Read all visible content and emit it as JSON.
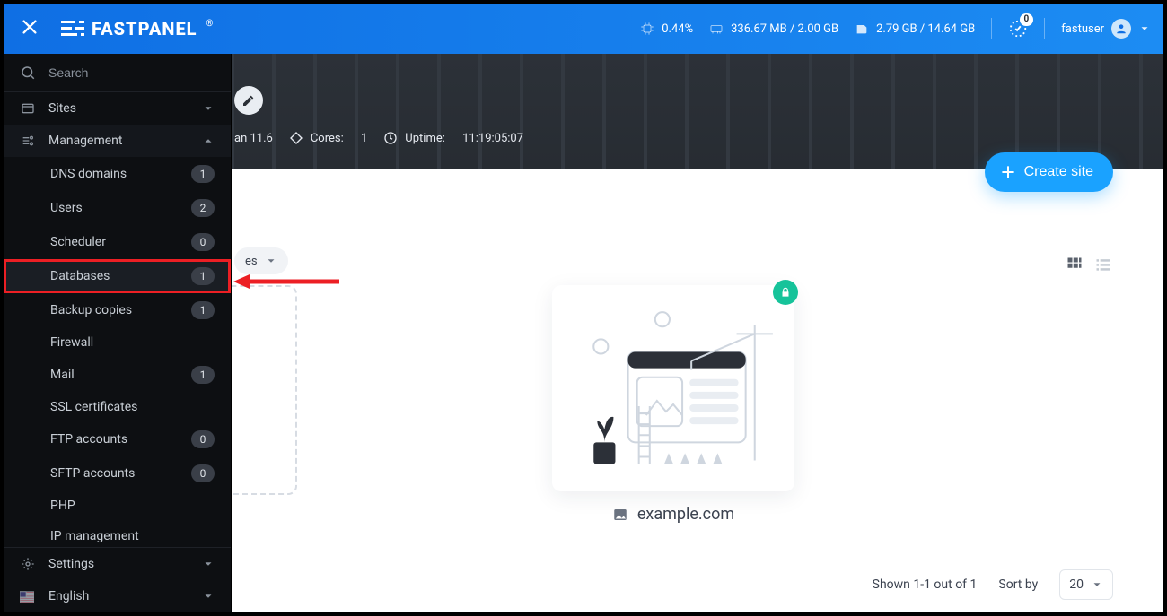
{
  "brand": {
    "name": "FASTPANEL",
    "regmark": "®"
  },
  "topbar": {
    "cpu_pct": "0.44%",
    "mem": "336.67 MB / 2.00 GB",
    "disk": "2.79 GB / 14.64 GB",
    "notif_count": "0",
    "username": "fastuser"
  },
  "sidebar": {
    "search_placeholder": "Search",
    "sites_label": "Sites",
    "management_label": "Management",
    "management_items": [
      {
        "label": "DNS domains",
        "count": "1"
      },
      {
        "label": "Users",
        "count": "2"
      },
      {
        "label": "Scheduler",
        "count": "0"
      },
      {
        "label": "Databases",
        "count": "1",
        "highlight": true
      },
      {
        "label": "Backup copies",
        "count": "1"
      },
      {
        "label": "Firewall"
      },
      {
        "label": "Mail",
        "count": "1"
      },
      {
        "label": "SSL certificates"
      },
      {
        "label": "FTP accounts",
        "count": "0"
      },
      {
        "label": "SFTP accounts",
        "count": "0"
      },
      {
        "label": "PHP"
      },
      {
        "label": "IP management"
      }
    ],
    "settings_label": "Settings",
    "language_label": "English"
  },
  "hero": {
    "os": "an 11.6",
    "cores_label": "Cores:",
    "cores_value": "1",
    "uptime_label": "Uptime:",
    "uptime_value": "11:19:05:07"
  },
  "actions": {
    "create_site": "Create site"
  },
  "filter": {
    "chip_label": "es"
  },
  "cards": {
    "site1_name": "example.com"
  },
  "pager": {
    "shown_text": "Shown 1-1 out of 1",
    "sort_label": "Sort by",
    "page_size": "20"
  }
}
